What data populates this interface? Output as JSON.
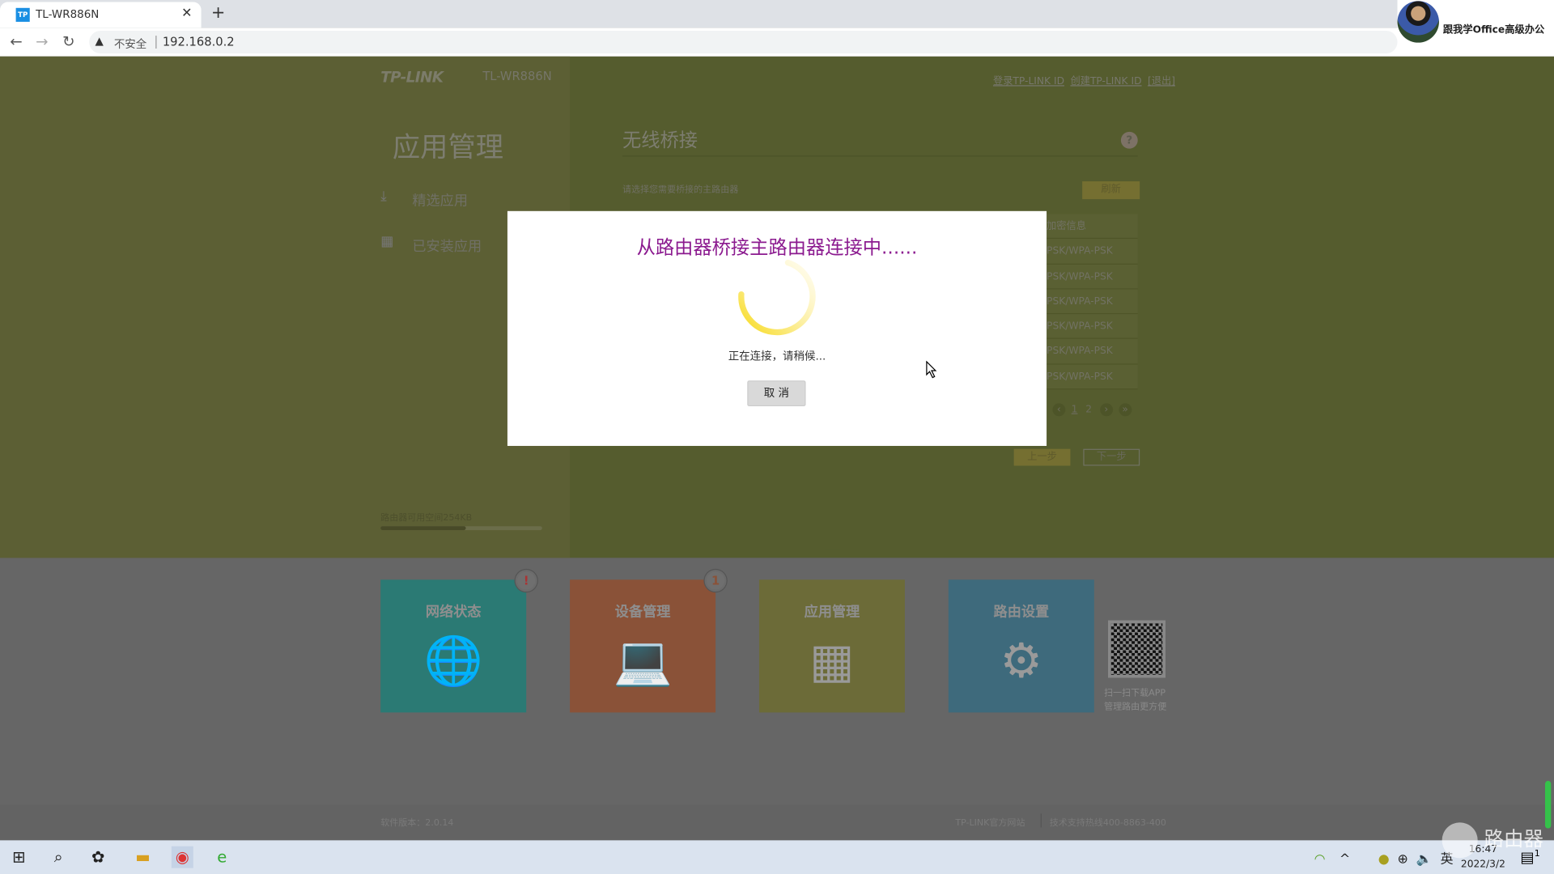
{
  "browser": {
    "tab_title": "TL-WR886N",
    "tab_favicon": "TP",
    "security_label": "不安全",
    "url": "192.168.0.2",
    "profile_name": "跟我学Office高级办公"
  },
  "header": {
    "brand": "TP-LINK",
    "model": "TL-WR886N",
    "links": [
      "登录TP-LINK ID",
      "创建TP-LINK ID",
      "[退出]"
    ]
  },
  "sidebar": {
    "title": "应用管理",
    "items": [
      {
        "label": "精选应用",
        "icon": "download-icon"
      },
      {
        "label": "已安装应用",
        "icon": "grid-icon"
      }
    ],
    "storage_text": "路由器可用空间254KB",
    "storage_used_percent": 53
  },
  "main": {
    "title": "无线桥接",
    "prompt": "请选择您需要桥接的主路由器",
    "refresh_label": "刷新",
    "table_header": "加密信息",
    "table_rows": [
      "PSK/WPA-PSK",
      "PSK/WPA-PSK",
      "PSK/WPA-PSK",
      "PSK/WPA-PSK",
      "PSK/WPA-PSK",
      "PSK/WPA-PSK"
    ],
    "pager": {
      "first": "‹",
      "pages": [
        "1",
        "2"
      ],
      "next": "›",
      "last": "»"
    },
    "prev_label": "上一步",
    "next_label": "下一步"
  },
  "dialog": {
    "title": "从路由器桥接主路由器连接中......",
    "message": "正在连接，请稍候...",
    "cancel_label": "取 消"
  },
  "tiles": [
    {
      "label": "网络状态",
      "badge": "!",
      "color": "#2b7a74"
    },
    {
      "label": "设备管理",
      "badge": "1",
      "color": "#8a5238"
    },
    {
      "label": "应用管理",
      "badge": "",
      "color": "#6c6b38"
    },
    {
      "label": "路由设置",
      "badge": "",
      "color": "#3e6a7c"
    }
  ],
  "qr_text": [
    "扫一扫下载APP",
    "管理路由更方便"
  ],
  "footer": {
    "version": "软件版本：2.0.14",
    "site": "TP-LINK官方网站",
    "hotline": "技术支持热线400-8863-400"
  },
  "taskbar": {
    "ime": "英",
    "time": "16:47",
    "date": "2022/3/2",
    "notifications": "1"
  },
  "watermark": "路由器"
}
